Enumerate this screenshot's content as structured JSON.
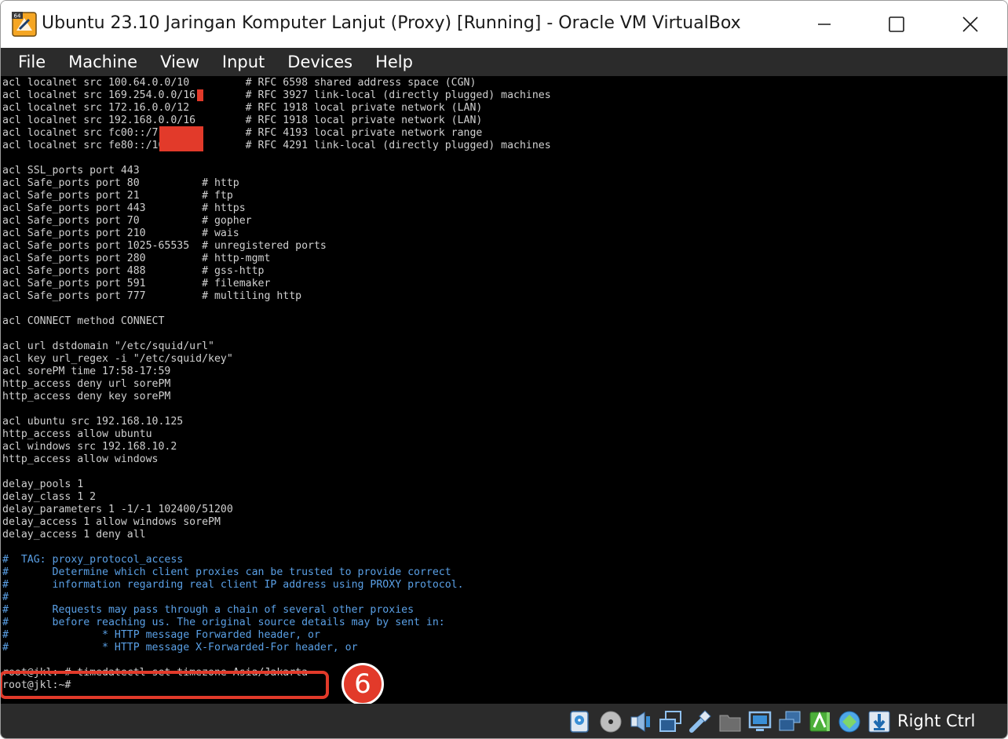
{
  "window": {
    "title": "Ubuntu 23.10 Jaringan Komputer Lanjut (Proxy) [Running] - Oracle VM VirtualBox",
    "app_icon_badge": "64"
  },
  "menu": [
    "File",
    "Machine",
    "View",
    "Input",
    "Devices",
    "Help"
  ],
  "terminal": {
    "lines": [
      {
        "text": "acl localnet src 100.64.0.0/10         # RFC 6598 shared address space (CGN)",
        "type": "normal"
      },
      {
        "text": "acl localnet src 169.254.0.0/16        # RFC 3927 link-local (directly plugged) machines",
        "type": "normal"
      },
      {
        "text": "acl localnet src 172.16.0.0/12         # RFC 1918 local private network (LAN)",
        "type": "normal"
      },
      {
        "text": "acl localnet src 192.168.0.0/16        # RFC 1918 local private network (LAN)",
        "type": "normal"
      },
      {
        "text": "acl localnet src fc00::/7              # RFC 4193 local private network range",
        "type": "normal"
      },
      {
        "text": "acl localnet src fe80::/10             # RFC 4291 link-local (directly plugged) machines",
        "type": "normal"
      },
      {
        "text": "",
        "type": "normal"
      },
      {
        "text": "acl SSL_ports port 443",
        "type": "normal"
      },
      {
        "text": "acl Safe_ports port 80          # http",
        "type": "normal"
      },
      {
        "text": "acl Safe_ports port 21          # ftp",
        "type": "normal"
      },
      {
        "text": "acl Safe_ports port 443         # https",
        "type": "normal"
      },
      {
        "text": "acl Safe_ports port 70          # gopher",
        "type": "normal"
      },
      {
        "text": "acl Safe_ports port 210         # wais",
        "type": "normal"
      },
      {
        "text": "acl Safe_ports port 1025-65535  # unregistered ports",
        "type": "normal"
      },
      {
        "text": "acl Safe_ports port 280         # http-mgmt",
        "type": "normal"
      },
      {
        "text": "acl Safe_ports port 488         # gss-http",
        "type": "normal"
      },
      {
        "text": "acl Safe_ports port 591         # filemaker",
        "type": "normal"
      },
      {
        "text": "acl Safe_ports port 777         # multiling http",
        "type": "normal"
      },
      {
        "text": "",
        "type": "normal"
      },
      {
        "text": "acl CONNECT method CONNECT",
        "type": "normal"
      },
      {
        "text": "",
        "type": "normal"
      },
      {
        "text": "acl url dstdomain \"/etc/squid/url\"",
        "type": "normal"
      },
      {
        "text": "acl key url_regex -i \"/etc/squid/key\"",
        "type": "normal"
      },
      {
        "text": "acl sorePM time 17:58-17:59",
        "type": "normal"
      },
      {
        "text": "http_access deny url sorePM",
        "type": "normal"
      },
      {
        "text": "http_access deny key sorePM",
        "type": "normal"
      },
      {
        "text": "",
        "type": "normal"
      },
      {
        "text": "acl ubuntu src 192.168.10.125",
        "type": "normal"
      },
      {
        "text": "http_access allow ubuntu",
        "type": "normal"
      },
      {
        "text": "acl windows src 192.168.10.2",
        "type": "normal"
      },
      {
        "text": "http_access allow windows",
        "type": "normal"
      },
      {
        "text": "",
        "type": "normal"
      },
      {
        "text": "delay_pools 1",
        "type": "normal"
      },
      {
        "text": "delay_class 1 2",
        "type": "normal"
      },
      {
        "text": "delay_parameters 1 -1/-1 102400/51200",
        "type": "normal"
      },
      {
        "text": "delay_access 1 allow windows sorePM",
        "type": "normal"
      },
      {
        "text": "delay_access 1 deny all",
        "type": "normal"
      },
      {
        "text": "",
        "type": "normal"
      },
      {
        "text": "#  TAG: proxy_protocol_access",
        "type": "comment"
      },
      {
        "text": "#       Determine which client proxies can be trusted to provide correct",
        "type": "comment"
      },
      {
        "text": "#       information regarding real client IP address using PROXY protocol.",
        "type": "comment"
      },
      {
        "text": "#",
        "type": "comment"
      },
      {
        "text": "#       Requests may pass through a chain of several other proxies",
        "type": "comment"
      },
      {
        "text": "#       before reaching us. The original source details may by sent in:",
        "type": "comment"
      },
      {
        "text": "#               * HTTP message Forwarded header, or",
        "type": "comment"
      },
      {
        "text": "#               * HTTP message X-Forwarded-For header, or",
        "type": "comment"
      },
      {
        "text": "",
        "type": "normal"
      },
      {
        "text": "root@jkl:~# timedatectl set-timezone Asia/Jakarta",
        "type": "normal"
      },
      {
        "text": "root@jkl:~#",
        "type": "normal"
      }
    ],
    "step_number": "6"
  },
  "statusbar": {
    "icons": [
      "hard-disk-icon",
      "optical-disc-icon",
      "audio-icon",
      "network-icon",
      "usb-icon",
      "shared-folders-icon",
      "display-icon",
      "recording-icon",
      "guest-additions-icon",
      "mouse-integration-icon",
      "keyboard-capture-icon"
    ],
    "host_key_label": "Right Ctrl"
  }
}
